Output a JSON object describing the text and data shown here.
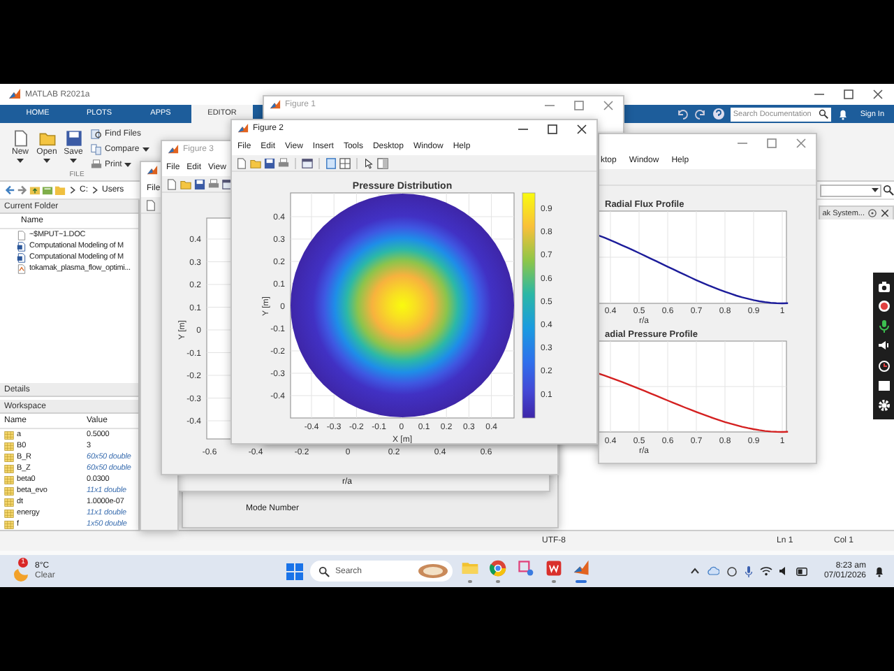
{
  "matlab": {
    "title": "MATLAB R2021a",
    "ribbon_tabs": [
      {
        "label": "HOME",
        "selected": false
      },
      {
        "label": "PLOTS",
        "selected": false
      },
      {
        "label": "APPS",
        "selected": false
      },
      {
        "label": "EDITOR",
        "selected": true
      }
    ],
    "search": {
      "placeholder": "Search Documentation"
    },
    "sign_in": "Sign In",
    "file_buttons": [
      {
        "kind": "new",
        "label": "New"
      },
      {
        "kind": "open",
        "label": "Open"
      },
      {
        "kind": "save",
        "label": "Save"
      }
    ],
    "file_actions": [
      {
        "kind": "find",
        "label": "Find Files"
      },
      {
        "kind": "compare",
        "label": "Compare"
      },
      {
        "kind": "print",
        "label": "Print"
      }
    ],
    "group_label": "FILE",
    "path": [
      "C:",
      "Users"
    ],
    "current_folder": {
      "title": "Current Folder",
      "column": "Name",
      "files": [
        {
          "kind": "file",
          "name": "~$MPUT~1.DOC"
        },
        {
          "kind": "doc",
          "name": "Computational Modeling of M"
        },
        {
          "kind": "doc",
          "name": "Computational Modeling of M"
        },
        {
          "kind": "script",
          "name": "tokamak_plasma_flow_optimi..."
        }
      ]
    },
    "details": "Details",
    "workspace": {
      "title": "Workspace",
      "columns": [
        "Name",
        "Value"
      ],
      "rows": [
        {
          "name": "a",
          "value": "0.5000",
          "kind": "scalar"
        },
        {
          "name": "B0",
          "value": "3",
          "kind": "scalar"
        },
        {
          "name": "B_R",
          "value": "60x50 double",
          "kind": "array"
        },
        {
          "name": "B_Z",
          "value": "60x50 double",
          "kind": "array"
        },
        {
          "name": "beta0",
          "value": "0.0300",
          "kind": "scalar"
        },
        {
          "name": "beta_evo",
          "value": "11x1 double",
          "kind": "array"
        },
        {
          "name": "dt",
          "value": "1.0000e-07",
          "kind": "scalar"
        },
        {
          "name": "energy",
          "value": "11x1 double",
          "kind": "array"
        },
        {
          "name": "f",
          "value": "1x50 double",
          "kind": "array"
        }
      ]
    },
    "editor_tab": "ak System...",
    "status": [
      "UTF-8",
      "Ln 1",
      "Col 1"
    ]
  },
  "windows": [
    {
      "kind": "stack_back",
      "axis_label": "Mode Number"
    },
    {
      "kind": "stack_front",
      "axis_label": "r/a"
    },
    {
      "kind": "side",
      "menu": [
        "File"
      ]
    },
    {
      "kind": "figure3",
      "title": "Figure 3",
      "active": false,
      "menu": [
        "File",
        "Edit",
        "View"
      ],
      "ylabel": "Y [m]",
      "yticks": [
        "0.4",
        "0.3",
        "0.2",
        "0.1",
        "0",
        "-0.1",
        "-0.2",
        "-0.3",
        "-0.4"
      ],
      "xticks": [
        "-0.6",
        "-0.4",
        "-0.2",
        "0",
        "0.2",
        "0.4",
        "0.6"
      ]
    },
    {
      "kind": "figure1",
      "title": "Figure 1",
      "active": false
    },
    {
      "kind": "profiles",
      "menu": [
        "ktop",
        "Window",
        "Help"
      ],
      "plots": [
        {
          "title": "Radial Flux Profile",
          "xlabel": "r/a",
          "xticks": [
            "0.4",
            "0.5",
            "0.6",
            "0.7",
            "0.8",
            "0.9",
            "1"
          ],
          "color": "#1c1c9a"
        },
        {
          "title": "adial Pressure Profile",
          "xlabel": "r/a",
          "xticks": [
            "0.4",
            "0.5",
            "0.6",
            "0.7",
            "0.8",
            "0.9",
            "1"
          ],
          "color": "#d42020"
        }
      ]
    },
    {
      "kind": "figure2",
      "title": "Figure 2",
      "active": true,
      "menu": [
        "File",
        "Edit",
        "View",
        "Insert",
        "Tools",
        "Desktop",
        "Window",
        "Help"
      ],
      "plot": {
        "title": "Pressure Distribution",
        "xlabel": "X [m]",
        "ylabel": "Y [m]",
        "xticks": [
          "-0.4",
          "-0.3",
          "-0.2",
          "-0.1",
          "0",
          "0.1",
          "0.2",
          "0.3",
          "0.4"
        ],
        "yticks": [
          "0.4",
          "0.3",
          "0.2",
          "0.1",
          "0",
          "-0.1",
          "-0.2",
          "-0.3",
          "-0.4"
        ],
        "colorbar_ticks": [
          "0.9",
          "0.8",
          "0.7",
          "0.6",
          "0.5",
          "0.4",
          "0.3",
          "0.2",
          "0.1"
        ]
      }
    }
  ],
  "taskbar": {
    "weather": {
      "badge": "1",
      "temperature": "8°C",
      "condition": "Clear"
    },
    "search": {
      "placeholder": "Search"
    },
    "apps": [
      {
        "kind": "files",
        "running": true,
        "selected": false
      },
      {
        "kind": "browser",
        "running": true,
        "selected": false
      },
      {
        "kind": "snip",
        "running": false,
        "selected": false
      },
      {
        "kind": "office",
        "running": true,
        "selected": false
      },
      {
        "kind": "matlab",
        "running": true,
        "selected": true
      }
    ],
    "time": "8:23 am",
    "date": "07/01/2026"
  }
}
